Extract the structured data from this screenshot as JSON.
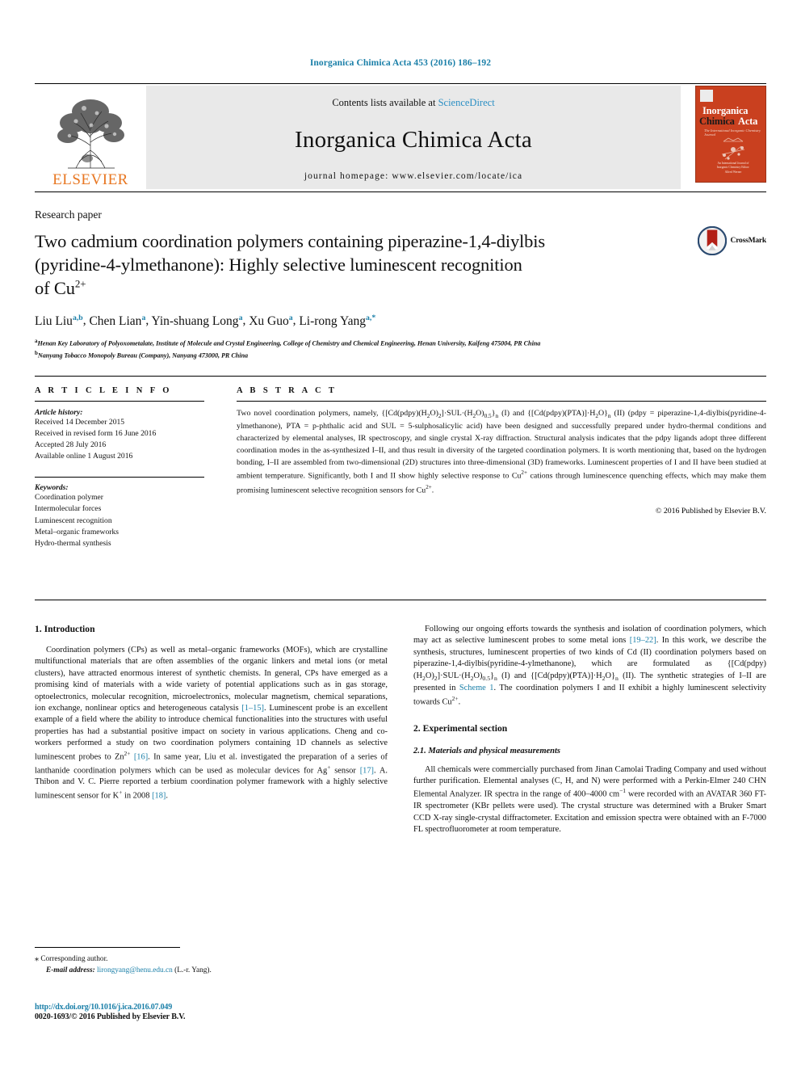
{
  "running_head": "Inorganica Chimica Acta 453 (2016) 186–192",
  "masthead": {
    "publisher_logo_text": "ELSEVIER",
    "contents_prefix": "Contents lists available at ",
    "contents_link": "ScienceDirect",
    "journal_title": "Inorganica Chimica Acta",
    "homepage": "journal homepage: www.elsevier.com/locate/ica",
    "cover": {
      "line1": "Inorganica",
      "line2": "Chimica",
      "line3": "Acta",
      "subtitle": "The International Inorganic Chemistry Journal",
      "footer": "An International Journal of Inorganic Chemistry\nEditor: Alfred Werner"
    }
  },
  "article": {
    "kind": "Research paper",
    "title_line1": "Two cadmium coordination polymers containing piperazine-1,4-diylbis",
    "title_line2": "(pyridine-4-ylmethanone): Highly selective luminescent recognition",
    "title_line3_pre": "of Cu",
    "title_line3_sup": "2+",
    "crossmark_label": "CrossMark",
    "authors": [
      {
        "name": "Liu Liu",
        "sup": "a,b"
      },
      {
        "name": "Chen Lian",
        "sup": "a"
      },
      {
        "name": "Yin-shuang Long",
        "sup": "a"
      },
      {
        "name": "Xu Guo",
        "sup": "a"
      },
      {
        "name": "Li-rong Yang",
        "sup": "a,*"
      }
    ],
    "affiliations": [
      {
        "mark": "a",
        "text": "Henan Key Laboratory of Polyoxometalate, Institute of Molecule and Crystal Engineering, College of Chemistry and Chemical Engineering, Henan University, Kaifeng 475004, PR China"
      },
      {
        "mark": "b",
        "text": "Nanyang Tobacco Monopoly Bureau (Company), Nanyang 473000, PR China"
      }
    ]
  },
  "article_info": {
    "heading": "A R T I C L E   I N F O",
    "history_label": "Article history:",
    "history": [
      "Received 14 December 2015",
      "Received in revised form 16 June 2016",
      "Accepted 28 July 2016",
      "Available online 1 August 2016"
    ],
    "keywords_label": "Keywords:",
    "keywords": [
      "Coordination polymer",
      "Intermolecular forces",
      "Luminescent recognition",
      "Metal–organic frameworks",
      "Hydro-thermal synthesis"
    ]
  },
  "abstract": {
    "heading": "A B S T R A C T",
    "text_parts": {
      "p1": "Two novel coordination polymers, namely, {[Cd(pdpy)(H",
      "p2": "2",
      "p3": "O)",
      "p4": "2",
      "p5": "]·SUL·(H",
      "p6": "2",
      "p7": "O)",
      "p8": "0.5",
      "p9": "}",
      "p10": "n",
      "p11": " (I) and {[Cd(pdpy)(PTA)]·H",
      "p12": "2",
      "p13": "O}",
      "p14": "n",
      "p15": " (II) (pdpy = piperazine-1,4-diylbis(pyridine-4-ylmethanone), PTA = p-phthalic acid and SUL = 5-sulphosalicylic acid) have been designed and successfully prepared under hydro-thermal conditions and characterized by elemental analyses, IR spectroscopy, and single crystal X-ray diffraction. Structural analysis indicates that the pdpy ligands adopt three different coordination modes in the as-synthesized I–II, and thus result in diversity of the targeted coordination polymers. It is worth mentioning that, based on the hydrogen bonding, I–II are assembled from two-dimensional (2D) structures into three-dimensional (3D) frameworks. Luminescent properties of I and II have been studied at ambient temperature. Significantly, both I and II show highly selective response to Cu",
      "p16": "2+",
      "p17": " cations through luminescence quenching effects, which may make them promising luminescent selective recognition sensors for Cu",
      "p18": "2+",
      "p19": "."
    },
    "copyright": "© 2016 Published by Elsevier B.V."
  },
  "sections": {
    "intro_heading": "1. Introduction",
    "intro_p1_a": "Coordination polymers (CPs) as well as metal–organic frameworks (MOFs), which are crystalline multifunctional materials that are often assemblies of the organic linkers and metal ions (or metal clusters), have attracted enormous interest of synthetic chemists. In general, CPs have emerged as a promising kind of materials with a wide variety of potential applications such as in gas storage, optoelectronics, molecular recognition, microelectronics, molecular magnetism, chemical separations, ion exchange, nonlinear optics and heterogeneous catalysis ",
    "intro_ref1": "[1–15]",
    "intro_p1_b": ". Luminescent probe is an excellent example of a field where the ability to introduce chemical functionalities into the structures with useful properties has had a substantial positive impact on society in various applications. Cheng and co-workers performed a study on two coordination polymers containing 1D channels as selective luminescent probes to Zn",
    "intro_sup1": "2+",
    "intro_p1_c": " ",
    "intro_ref2": "[16]",
    "intro_p1_d": ". In same year, Liu et al. investigated the preparation of a series of lanthanide coordination polymers which can be used as molecular devices for Ag",
    "intro_sup2": "+",
    "intro_p1_e": " sensor ",
    "intro_ref3": "[17]",
    "intro_p1_f": ". A. Thibon and V. C. Pierre reported a terbium coordination polymer framework with a highly selective luminescent sensor for K",
    "intro_sup3": "+",
    "intro_p1_g": " in 2008 ",
    "intro_ref4": "[18]",
    "intro_p1_h": ".",
    "intro_p2_a": "Following our ongoing efforts towards the synthesis and isolation of coordination polymers, which may act as selective luminescent probes to some metal ions ",
    "intro_p2_ref": "[19–22]",
    "intro_p2_b": ". In this work, we describe the synthesis, structures, luminescent properties of two kinds of Cd (II) coordination polymers based on piperazine-1,4-diylbis(pyridine-4-ylmethanone), which are formulated as {[Cd(pdpy)(H",
    "intro_p2_sub1": "2",
    "intro_p2_c": "O)",
    "intro_p2_sub2": "2",
    "intro_p2_d": "]·SUL·(H",
    "intro_p2_sub3": "2",
    "intro_p2_e": "O)",
    "intro_p2_sub4": "0.5",
    "intro_p2_f": "}",
    "intro_p2_sub5": "n",
    "intro_p2_g": " (I) and {[Cd(pdpy)(PTA)]·H",
    "intro_p2_sub6": "2",
    "intro_p2_h": "O}",
    "intro_p2_sub7": "n",
    "intro_p2_i": " (II). The synthetic strategies of I–II are presented in ",
    "intro_p2_scheme": "Scheme 1",
    "intro_p2_j": ". The coordination polymers I and II exhibit a highly luminescent selectivity towards Cu",
    "intro_p2_sup": "2+",
    "intro_p2_k": ".",
    "exp_heading": "2. Experimental section",
    "exp_sub_heading": "2.1. Materials and physical measurements",
    "exp_p1_a": "All chemicals were commercially purchased from Jinan Camolai Trading Company and used without further purification. Elemental analyses (C, H, and N) were performed with a Perkin-Elmer 240 CHN Elemental Analyzer. IR spectra in the range of 400–4000 cm",
    "exp_p1_sup": "−1",
    "exp_p1_b": " were recorded with an AVATAR 360 FT-IR spectrometer (KBr pellets were used). The crystal structure was determined with a Bruker Smart CCD X-ray single-crystal diffractometer. Excitation and emission spectra were obtained with an F-7000 FL spectrofluorometer at room temperature."
  },
  "footnotes": {
    "corresponding_mark": "⁎",
    "corresponding_text": "Corresponding author.",
    "email_label": "E-mail address:",
    "email": "lirongyang@henu.edu.cn",
    "email_suffix": "(L.-r. Yang).",
    "doi": "http://dx.doi.org/10.1016/j.ica.2016.07.049",
    "issn": "0020-1693/© 2016 Published by Elsevier B.V."
  },
  "colors": {
    "link": "#1a7fa8",
    "elsevier_orange": "#e87722",
    "masthead_grey": "#e9e9e9",
    "cover_red": "#c9401f"
  }
}
